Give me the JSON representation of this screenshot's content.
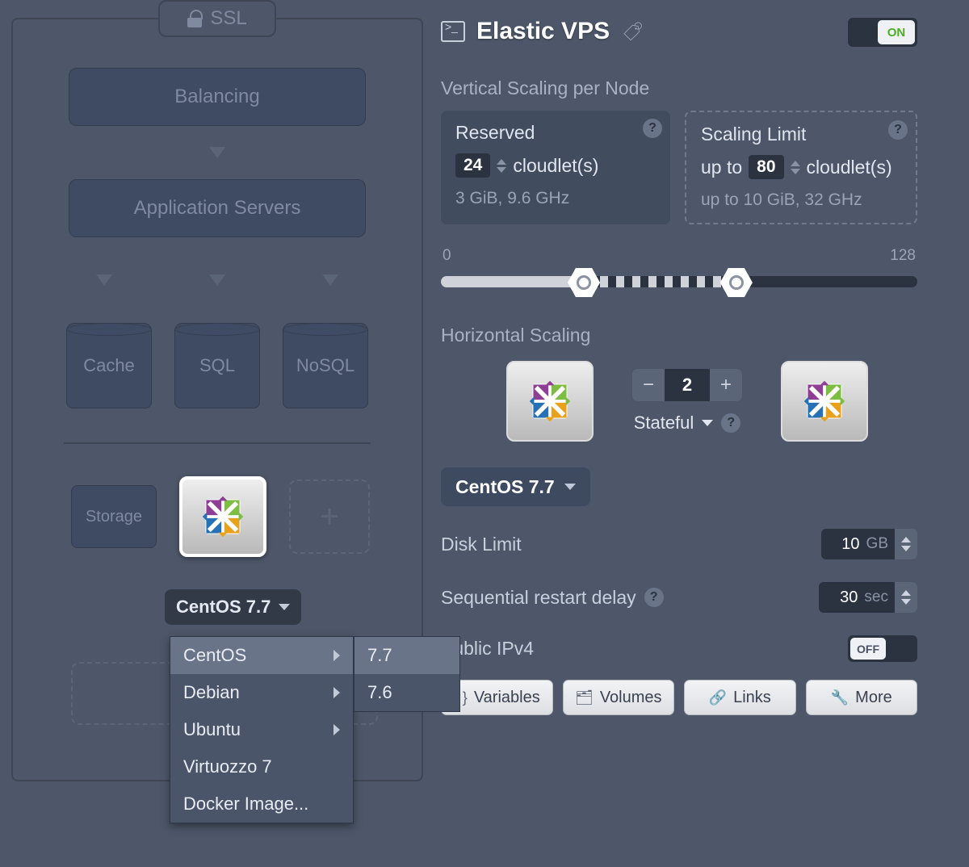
{
  "topology": {
    "ssl_label": "SSL",
    "balancing": "Balancing",
    "app_servers": "Application Servers",
    "db": {
      "cache": "Cache",
      "sql": "SQL",
      "nosql": "NoSQL"
    },
    "storage": "Storage",
    "plus": "+",
    "selected_version": "CentOS 7.7",
    "menu": {
      "items": [
        "CentOS",
        "Debian",
        "Ubuntu",
        "Virtuozzo 7",
        "Docker Image..."
      ],
      "submenu": [
        "7.7",
        "7.6"
      ]
    }
  },
  "config": {
    "title": "Elastic VPS",
    "toggle_on": "ON",
    "vertical_title": "Vertical Scaling per Node",
    "reserved": {
      "title": "Reserved",
      "value": "24",
      "unit": "cloudlet(s)",
      "spec": "3 GiB, 9.6 GHz"
    },
    "limit": {
      "title": "Scaling Limit",
      "prefix": "up to",
      "value": "80",
      "unit": "cloudlet(s)",
      "spec": "up to 10 GiB, 32 GHz"
    },
    "slider": {
      "min": "0",
      "max": "128"
    },
    "horizontal_title": "Horizontal Scaling",
    "count": "2",
    "stateful": "Stateful",
    "os_chip": "CentOS 7.7",
    "disk_limit": {
      "label": "Disk Limit",
      "value": "10",
      "unit": "GB"
    },
    "restart_delay": {
      "label": "Sequential restart delay",
      "value": "30",
      "unit": "sec"
    },
    "ipv4": {
      "label": "Public IPv4",
      "state": "OFF"
    },
    "buttons": {
      "variables": "Variables",
      "volumes": "Volumes",
      "links": "Links",
      "more": "More"
    }
  }
}
